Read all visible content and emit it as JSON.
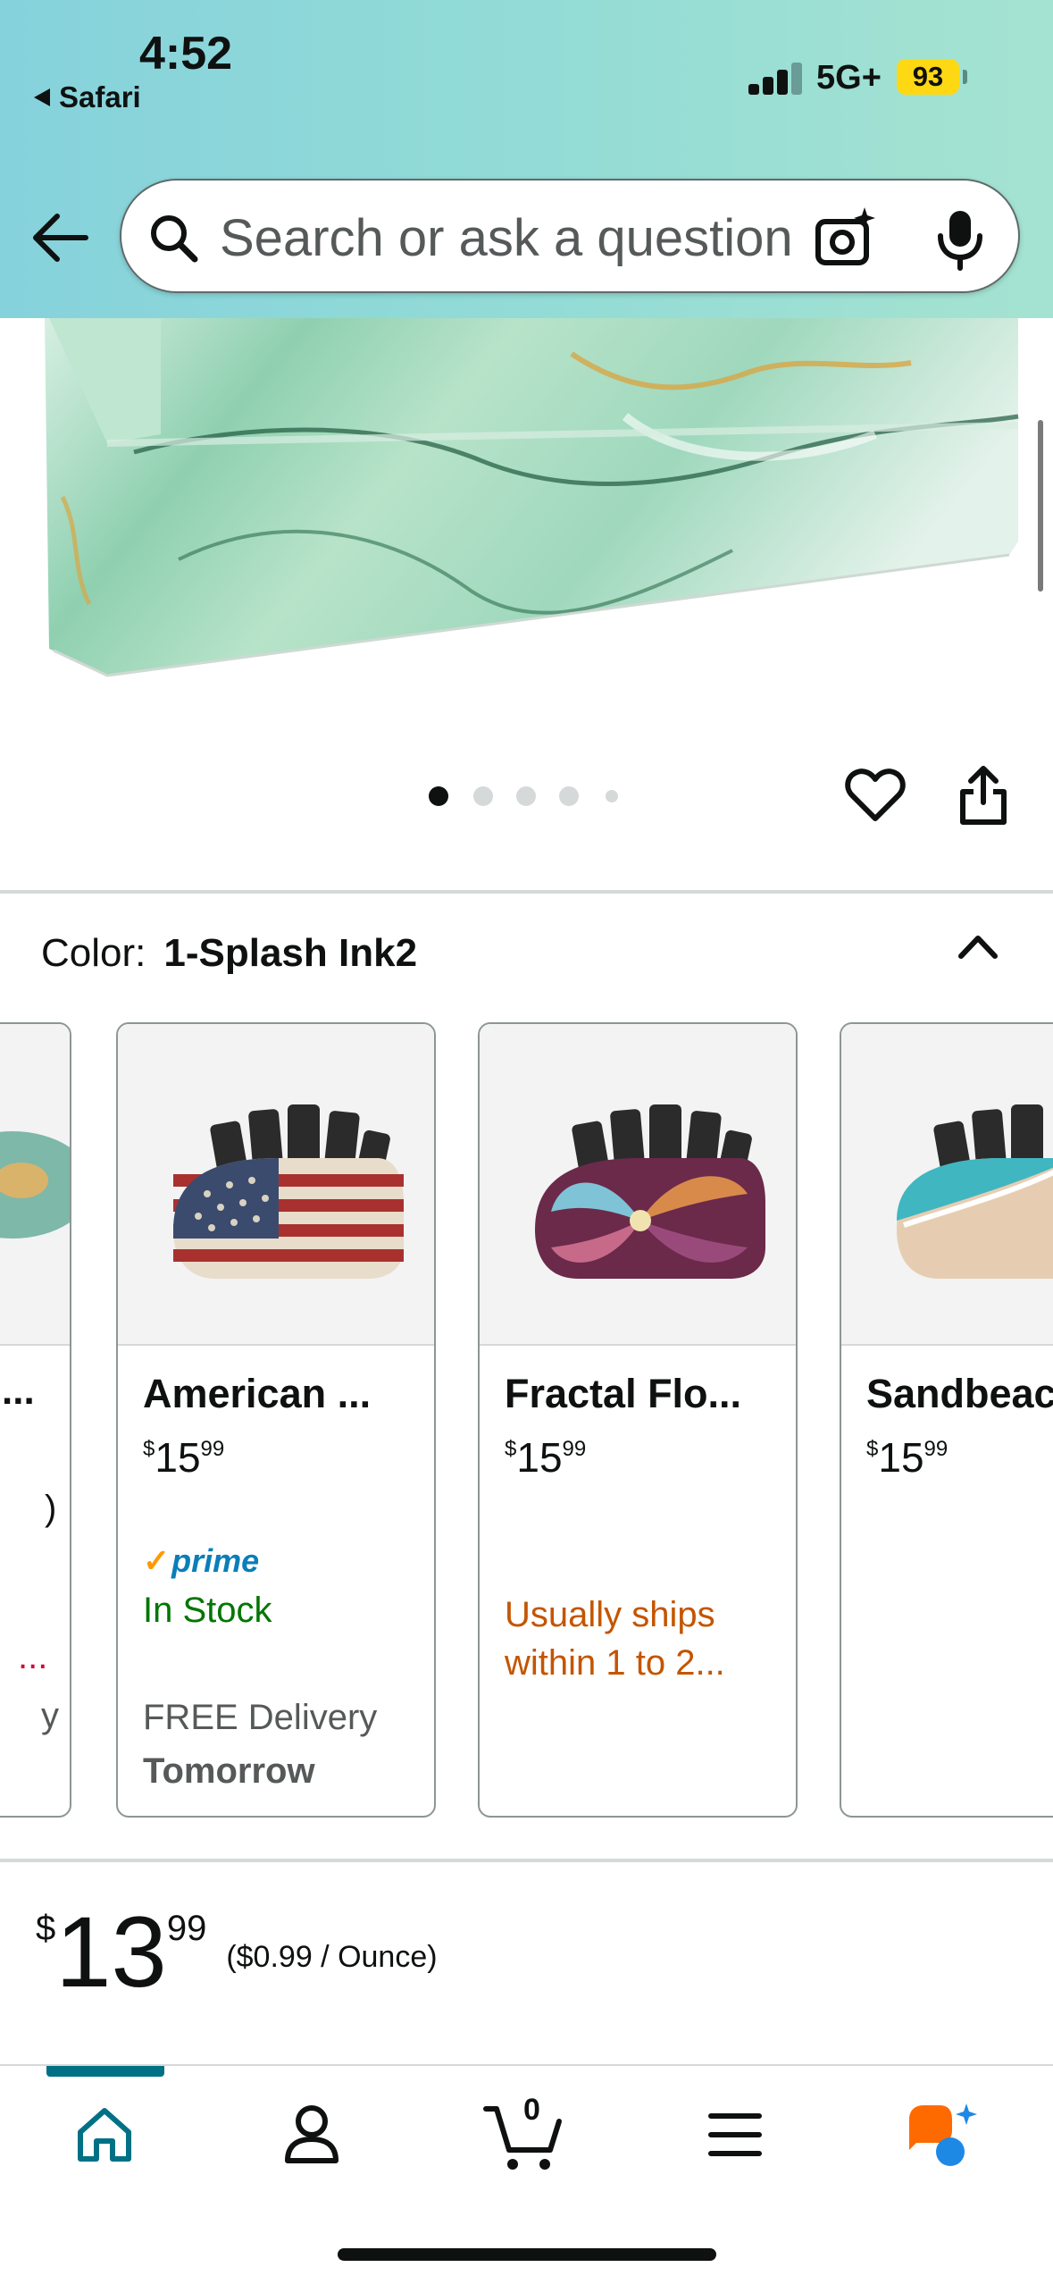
{
  "status_bar": {
    "time": "4:52",
    "back_app": "Safari",
    "network": "5G+",
    "battery": "93"
  },
  "search": {
    "placeholder": "Search or ask a question"
  },
  "gallery": {
    "image_count": 5,
    "active_index": 0
  },
  "color": {
    "label": "Color:",
    "value": "1-Splash Ink2"
  },
  "swatches": [
    {
      "name": "American ...",
      "price_symbol": "$",
      "price_whole": "15",
      "price_fraction": "99",
      "prime": "prime",
      "availability": "In Stock",
      "delivery_line1": "FREE Delivery",
      "delivery_line2": "Tomorrow"
    },
    {
      "name": "Fractal Flo...",
      "price_symbol": "$",
      "price_whole": "15",
      "price_fraction": "99",
      "availability": "Usually ships within 1 to 2..."
    },
    {
      "name": "Sandbeac",
      "price_symbol": "$",
      "price_whole": "15",
      "price_fraction": "99"
    }
  ],
  "partial_left_card": {
    "name_fragment": "...",
    "line_fragment": ")",
    "ship_fragment": "...",
    "delivery_fragment": "y"
  },
  "price": {
    "symbol": "$",
    "whole": "13",
    "fraction": "99",
    "unit_price": "($0.99 / Ounce)"
  },
  "cart": {
    "count": "0"
  },
  "colors": {
    "prime_blue": "#0a7eb9",
    "in_stock_green": "#007600",
    "ships_orange": "#c45500",
    "active_teal": "#007185",
    "rufus_orange": "#ff6a00",
    "rufus_blue": "#1e88e5"
  }
}
